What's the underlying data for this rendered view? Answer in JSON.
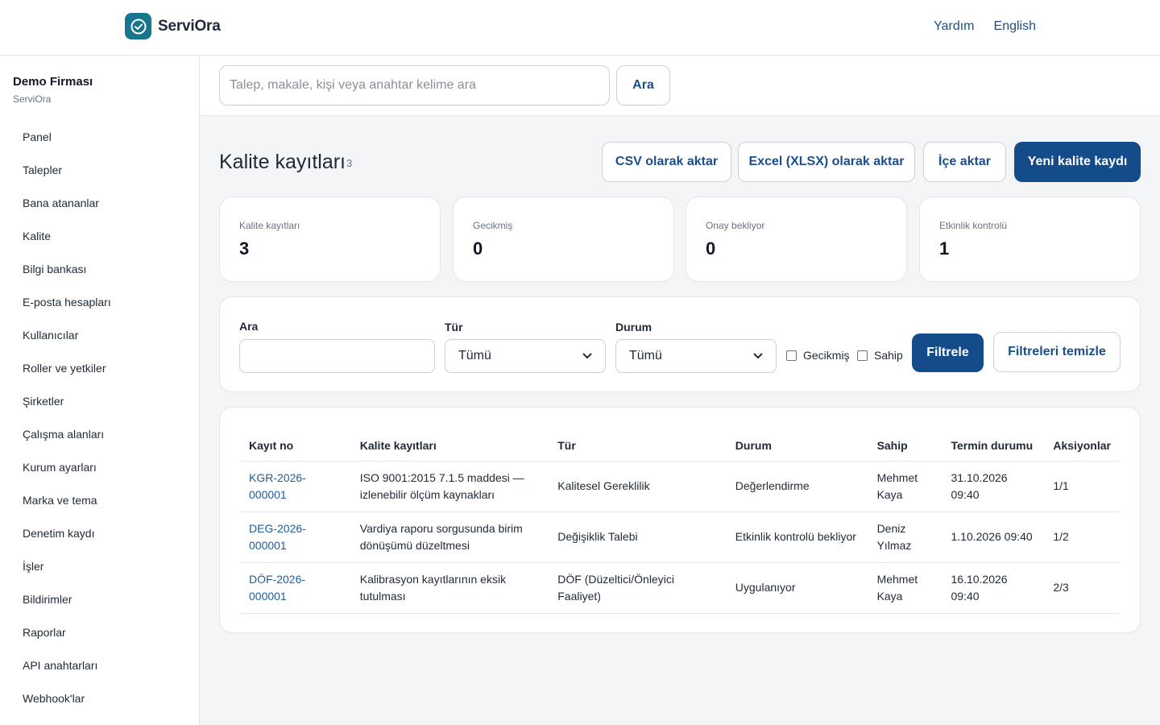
{
  "app": {
    "name": "ServiOra",
    "top_links": [
      "Yardım",
      "English"
    ]
  },
  "sidebar": {
    "org_name": "Demo Firması",
    "org_sub": "ServiOra",
    "items": [
      "Panel",
      "Talepler",
      "Bana atananlar",
      "Kalite",
      "Bilgi bankası",
      "E-posta hesapları",
      "Kullanıcılar",
      "Roller ve yetkiler",
      "Şirketler",
      "Çalışma alanları",
      "Kurum ayarları",
      "Marka ve tema",
      "Denetim kaydı",
      "İşler",
      "Bildirimler",
      "Raporlar",
      "API anahtarları",
      "Webhook'lar"
    ]
  },
  "search": {
    "placeholder": "Talep, makale, kişi veya anahtar kelime ara",
    "value": "",
    "button": "Ara"
  },
  "header": {
    "title": "Kalite kayıtları",
    "count": "3",
    "actions": {
      "csv": "CSV olarak aktar",
      "excel": "Excel (XLSX) olarak aktar",
      "import": "İçe aktar",
      "new": "Yeni kalite kaydı"
    }
  },
  "stats": [
    {
      "label": "Kalite kayıtları",
      "value": "3"
    },
    {
      "label": "Gecikmiş",
      "value": "0"
    },
    {
      "label": "Onay bekliyor",
      "value": "0"
    },
    {
      "label": "Etkinlik kontrolü",
      "value": "1"
    }
  ],
  "filters": {
    "search_label": "Ara",
    "search_value": "",
    "type_label": "Tür",
    "type_value": "Tümü",
    "status_label": "Durum",
    "status_value": "Tümü",
    "overdue_label": "Gecikmiş",
    "owner_label": "Sahip",
    "filter_button": "Filtrele",
    "clear_button": "Filtreleri temizle"
  },
  "table": {
    "columns": [
      "Kayıt no",
      "Kalite kayıtları",
      "Tür",
      "Durum",
      "Sahip",
      "Termin durumu",
      "Aksiyonlar"
    ],
    "rows": [
      {
        "id": "KGR-2026-000001",
        "title": "ISO 9001:2015 7.1.5 maddesi — izlenebilir ölçüm kaynakları",
        "type": "Kalitesel Gereklilik",
        "status": "Değerlendirme",
        "owner": "Mehmet Kaya",
        "due": "31.10.2026 09:40",
        "actions": "1/1"
      },
      {
        "id": "DEG-2026-000001",
        "title": "Vardiya raporu sorgusunda birim dönüşümü düzeltmesi",
        "type": "Değişiklik Talebi",
        "status": "Etkinlik kontrolü bekliyor",
        "owner": "Deniz Yılmaz",
        "due": "1.10.2026 09:40",
        "actions": "1/2"
      },
      {
        "id": "DÖF-2026-000001",
        "title": "Kalibrasyon kayıtlarının eksik tutulması",
        "type": "DÖF (Düzeltici/Önleyici Faaliyet)",
        "status": "Uygulanıyor",
        "owner": "Mehmet Kaya",
        "due": "16.10.2026 09:40",
        "actions": "2/3"
      }
    ]
  },
  "colors": {
    "brand": "#17768d",
    "primary": "#144c8a",
    "link": "#1d4e89"
  }
}
